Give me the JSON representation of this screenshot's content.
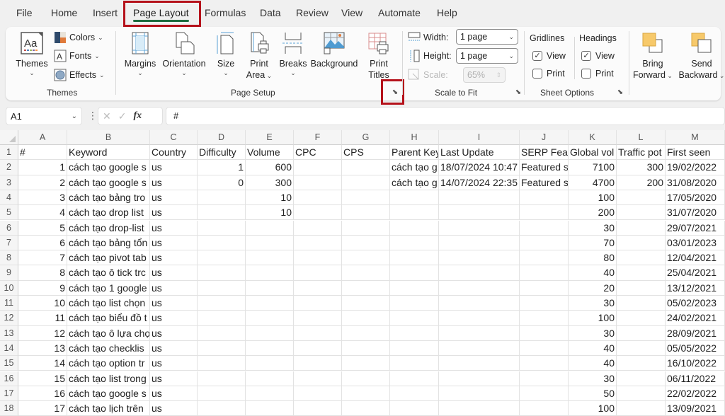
{
  "tabs": [
    {
      "label": "File",
      "active": false
    },
    {
      "label": "Home",
      "active": false
    },
    {
      "label": "Insert",
      "active": false
    },
    {
      "label": "Page Layout",
      "active": true
    },
    {
      "label": "Formulas",
      "active": false
    },
    {
      "label": "Data",
      "active": false
    },
    {
      "label": "Review",
      "active": false
    },
    {
      "label": "View",
      "active": false
    },
    {
      "label": "Automate",
      "active": false
    },
    {
      "label": "Help",
      "active": false
    }
  ],
  "colors": {
    "accent": "#1d6b3f",
    "highlight": "#b5121b"
  },
  "ribbon": {
    "themes_group": {
      "label": "Themes",
      "themes_button": "Themes",
      "colors_button": "Colors",
      "fonts_button": "Fonts",
      "effects_button": "Effects"
    },
    "page_setup_group": {
      "label": "Page Setup",
      "margins": "Margins",
      "orientation": "Orientation",
      "size": "Size",
      "print_area_line1": "Print",
      "print_area_line2": "Area",
      "breaks": "Breaks",
      "background": "Background",
      "print_titles_line1": "Print",
      "print_titles_line2": "Titles"
    },
    "scale_group": {
      "label": "Scale to Fit",
      "width_label": "Width:",
      "width_value": "1 page",
      "height_label": "Height:",
      "height_value": "1 page",
      "scale_label": "Scale:",
      "scale_value": "65%"
    },
    "sheet_options_group": {
      "label": "Sheet Options",
      "gridlines": "Gridlines",
      "headings": "Headings",
      "view": "View",
      "print": "Print",
      "gridlines_view_checked": true,
      "gridlines_print_checked": false,
      "headings_view_checked": true,
      "headings_print_checked": false
    },
    "arrange_group": {
      "bring_forward_line1": "Bring",
      "bring_forward_line2": "Forward",
      "send_backward_line1": "Send",
      "send_backward_line2": "Backward"
    }
  },
  "formula_bar": {
    "name_box": "A1",
    "fx": "fx",
    "formula": "#"
  },
  "sheet": {
    "columns": [
      "A",
      "B",
      "C",
      "D",
      "E",
      "F",
      "G",
      "H",
      "I",
      "J",
      "K",
      "L",
      "M"
    ],
    "rows": [
      [
        "#",
        "Keyword",
        "Country",
        "Difficulty",
        "Volume",
        "CPC",
        "CPS",
        "Parent Keyword",
        "Last Update",
        "SERP Features",
        "Global vol",
        "Traffic pot",
        "First seen"
      ],
      [
        "1",
        "cách tạo google s",
        "us",
        "1",
        "600",
        "",
        "",
        "cách tạo g",
        "18/07/2024 10:47",
        "Featured s",
        "7100",
        "300",
        "19/02/2022"
      ],
      [
        "2",
        "cách tạo google s",
        "us",
        "0",
        "300",
        "",
        "",
        "cách tạo g",
        "14/07/2024 22:35",
        "Featured s",
        "4700",
        "200",
        "31/08/2020"
      ],
      [
        "3",
        "cách tạo bảng tro",
        "us",
        "",
        "10",
        "",
        "",
        "",
        "",
        "",
        "100",
        "",
        "17/05/2020"
      ],
      [
        "4",
        "cách tạo drop list",
        "us",
        "",
        "10",
        "",
        "",
        "",
        "",
        "",
        "200",
        "",
        "31/07/2020"
      ],
      [
        "5",
        "cách tạo drop-list",
        "us",
        "",
        "",
        "",
        "",
        "",
        "",
        "",
        "30",
        "",
        "29/07/2021"
      ],
      [
        "6",
        "cách tạo bảng tổn",
        "us",
        "",
        "",
        "",
        "",
        "",
        "",
        "",
        "70",
        "",
        "03/01/2023"
      ],
      [
        "7",
        "cách tạo pivot tab",
        "us",
        "",
        "",
        "",
        "",
        "",
        "",
        "",
        "80",
        "",
        "12/04/2021"
      ],
      [
        "8",
        "cách tạo ô tick trc",
        "us",
        "",
        "",
        "",
        "",
        "",
        "",
        "",
        "40",
        "",
        "25/04/2021"
      ],
      [
        "9",
        "cách tạo 1 google",
        "us",
        "",
        "",
        "",
        "",
        "",
        "",
        "",
        "20",
        "",
        "13/12/2021"
      ],
      [
        "10",
        "cách tạo list chọn",
        "us",
        "",
        "",
        "",
        "",
        "",
        "",
        "",
        "30",
        "",
        "05/02/2023"
      ],
      [
        "11",
        "cách tạo biểu đồ t",
        "us",
        "",
        "",
        "",
        "",
        "",
        "",
        "",
        "100",
        "",
        "24/02/2021"
      ],
      [
        "12",
        "cách tạo ô lựa chọ",
        "us",
        "",
        "",
        "",
        "",
        "",
        "",
        "",
        "30",
        "",
        "28/09/2021"
      ],
      [
        "13",
        "cách tạo checklis",
        "us",
        "",
        "",
        "",
        "",
        "",
        "",
        "",
        "40",
        "",
        "05/05/2022"
      ],
      [
        "14",
        "cách tạo option tr",
        "us",
        "",
        "",
        "",
        "",
        "",
        "",
        "",
        "40",
        "",
        "16/10/2022"
      ],
      [
        "15",
        "cách tạo list trong",
        "us",
        "",
        "",
        "",
        "",
        "",
        "",
        "",
        "30",
        "",
        "06/11/2022"
      ],
      [
        "16",
        "cách tạo google s",
        "us",
        "",
        "",
        "",
        "",
        "",
        "",
        "",
        "50",
        "",
        "22/02/2022"
      ],
      [
        "17",
        "cách tạo lịch trên",
        "us",
        "",
        "",
        "",
        "",
        "",
        "",
        "",
        "100",
        "",
        "13/09/2021"
      ]
    ]
  }
}
